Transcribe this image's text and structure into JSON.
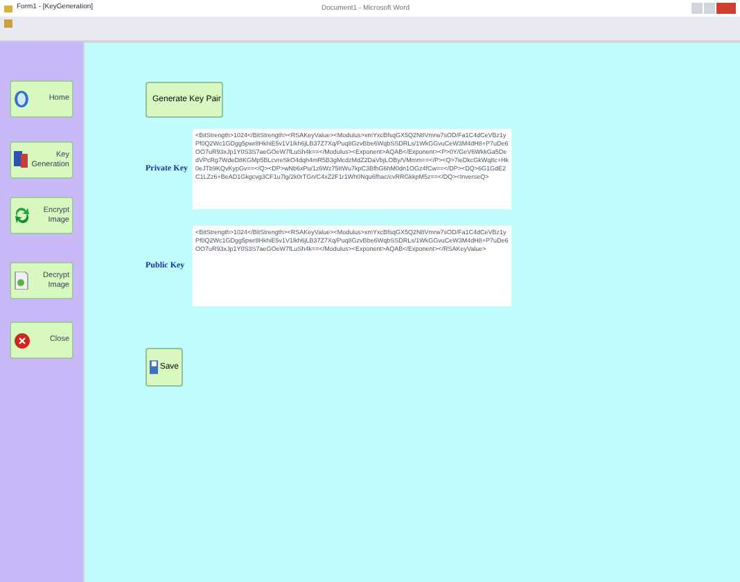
{
  "window": {
    "title": "Form1 - [KeyGeneration]",
    "background_title": "Document1 - Microsoft Word"
  },
  "sidebar": {
    "items": [
      {
        "label": "Home"
      },
      {
        "label": "Key Generation"
      },
      {
        "label": "Encrypt Image"
      },
      {
        "label": "Decrypt Image"
      },
      {
        "label": "Close"
      }
    ]
  },
  "generate_button": "Generate Key Pair",
  "private_key": {
    "label": "Private Key",
    "value": "<BitStrength>1024</BitStrength><RSAKeyValue><Modulus>xmYxcBfsqGX5Q2N8Vmrw7sOD/Fa1C4dCeVBz1yPf0Q2Wc1GDgg5pwr8HkhiE5v1V1lkh6jLB37Z7Xq/Puq8GzvBbe6WqbSSDRLs/1WkGGvuCeW3M4dH8+P7uDe6OO7uR93xJp1Y0S3S7aeGOeW7fLuSh4k==</Modulus><Exponent>AQAB</Exponent><P>0Y/GeV6WkkGa5DedVPcRg7WdeD8KGMp5BLcvreSkO4dqh4mR5B3gMcdzMdZ2DaVbjLOBy/VMmm==</P><Q>7ieDkcGkWq8c+Hk0eJTb9KQvKypGv==</Q><DP>wNb6xPu/1z6Wz75ItWu7kpC3BfhG6hM0dn1OGz4fCw==</DP><DQ>6G1GdE2C1LZz6+BeAD1Gkgcvg3CF1u7lg/2k0rTGn/C4xZ2F1r1Wh0Nqu6fhac/cvRRGkkpM5z==</DQ><InverseQ>"
  },
  "public_key": {
    "label": "Public Key",
    "value": "<BitStrength>1024</BitStrength><RSAKeyValue><Modulus>xmYxcBfsqGX5Q2N8Vmrw7sOD/Fa1C4dCeVBz1yPf0Q2Wc1GDgg5pwr8HkhiE5v1V1lkh6jLB37Z7Xq/Puq8GzvBbe6WqbSSDRLs/1WkGGvuCeW3M4dH8+P7uDe6OO7uR93xJp1Y0S3S7aeGOeW7fLuSh4k==</Modulus><Exponent>AQAB</Exponent></RSAKeyValue>"
  },
  "save_button": "Save"
}
